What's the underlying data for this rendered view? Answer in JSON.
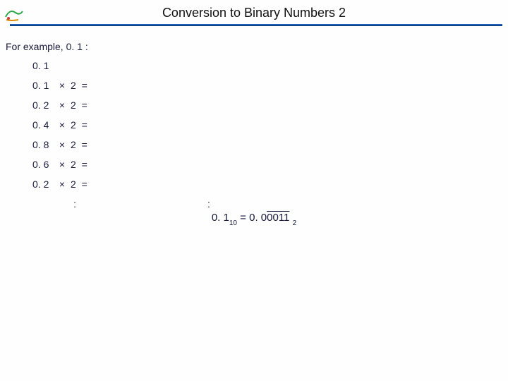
{
  "title": "Conversion to Binary Numbers 2",
  "intro": "For example, 0. 1 :",
  "first_value": "0. 1",
  "steps": [
    {
      "lhs": "0. 1",
      "op": "×",
      "mult": "2",
      "eq": "="
    },
    {
      "lhs": "0. 2",
      "op": "×",
      "mult": "2",
      "eq": "="
    },
    {
      "lhs": "0. 4",
      "op": "×",
      "mult": "2",
      "eq": "="
    },
    {
      "lhs": "0. 8",
      "op": "×",
      "mult": "2",
      "eq": "="
    },
    {
      "lhs": "0. 6",
      "op": "×",
      "mult": "2",
      "eq": "="
    },
    {
      "lhs": "0. 2",
      "op": "×",
      "mult": "2",
      "eq": "="
    }
  ],
  "ellipsis": ":",
  "result": {
    "lhs": "0. 1",
    "lhs_sub": "10",
    "eq": " = ",
    "rhs_prefix": "0. 0",
    "rhs_overline": "0011",
    "rhs_sub": "2"
  }
}
